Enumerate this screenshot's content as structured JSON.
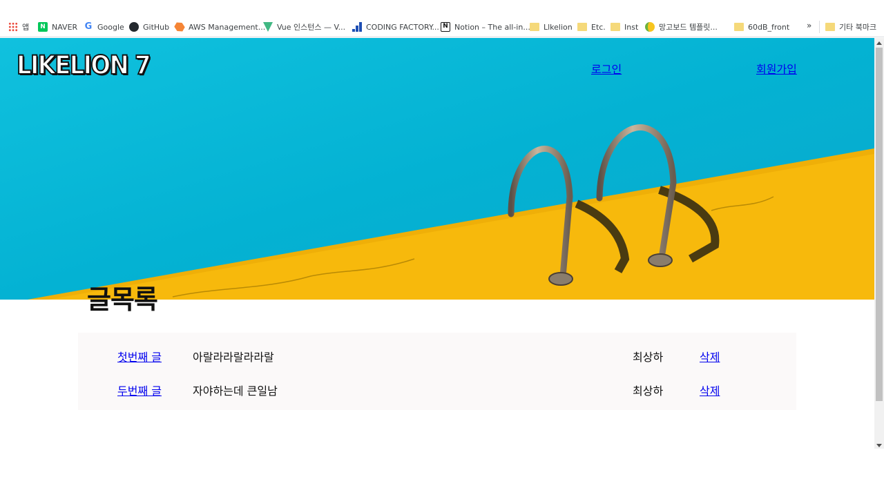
{
  "bookmarks": [
    {
      "label": "앱",
      "icon": "apps-grid-icon"
    },
    {
      "label": "NAVER",
      "icon": "naver-icon"
    },
    {
      "label": "Google",
      "icon": "google-icon"
    },
    {
      "label": "GitHub",
      "icon": "github-icon"
    },
    {
      "label": "AWS Management...",
      "icon": "aws-icon"
    },
    {
      "label": "Vue 인스턴스 — V...",
      "icon": "vue-icon"
    },
    {
      "label": "CODING FACTORY...",
      "icon": "coding-factory-icon"
    },
    {
      "label": "Notion – The all-in...",
      "icon": "notion-icon"
    },
    {
      "label": "Llkelion",
      "icon": "folder-icon"
    },
    {
      "label": "Etc.",
      "icon": "folder-icon"
    },
    {
      "label": "Inst",
      "icon": "folder-icon"
    },
    {
      "label": "망고보드 템플릿...",
      "icon": "mangoboard-icon"
    },
    {
      "label": "60dB_front",
      "icon": "folder-icon"
    }
  ],
  "bookmarks_more": "»",
  "other_bookmarks": {
    "label": "기타 북마크",
    "icon": "folder-icon"
  },
  "hero": {
    "logo": "LIKELION 7",
    "nav": {
      "login": "로그인",
      "signup": "회원가입"
    },
    "colors": {
      "pool": "#06b9d8",
      "deck": "#f7b90c"
    }
  },
  "page": {
    "title": "글목록",
    "posts": [
      {
        "title": "첫번째 글",
        "body": "아랄라라랄라라랄",
        "author": "최상하",
        "delete": "삭제"
      },
      {
        "title": "두번째 글",
        "body": "자야하는데 큰일남",
        "author": "최상하",
        "delete": "삭제"
      }
    ]
  }
}
